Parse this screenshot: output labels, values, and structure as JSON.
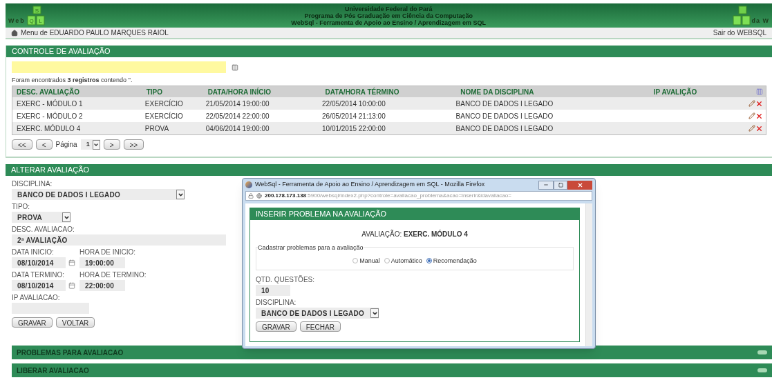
{
  "header": {
    "logo_left": {
      "text": "Web",
      "cube_letters": [
        "S",
        "Q",
        "L"
      ]
    },
    "title_lines": [
      "Universidade Federal do Pará",
      "Programa de Pós Graduação em Ciência da Computação",
      "WebSql - Ferramenta de Apoio ao Ensino / Aprendizagem em SQL"
    ],
    "logo_right": {
      "text": "da W"
    }
  },
  "menu_bar": {
    "user": "Menu de EDUARDO PAULO MARQUES RAIOL",
    "logout": "Sair do WEBSQL"
  },
  "controle": {
    "title": "CONTROLE DE AVALIAÇÃO",
    "result_text": "Foram encontrados **3 registros** contendo ''.",
    "columns": [
      "DESC. AVALIAÇÃO",
      "TIPO",
      "DATA/HORA INÍCIO",
      "DATA/HORA TÉRMINO",
      "NOME DA DISCIPLINA",
      "IP AVALIÇÃO"
    ],
    "rows": [
      {
        "cells": [
          "EXERC - MÓDULO 1",
          "EXERCÍCIO",
          "21/05/2014 19:00:00",
          "22/05/2014 10:00:00",
          "BANCO DE DADOS I LEGADO",
          ""
        ]
      },
      {
        "cells": [
          "EXERC - MÓDULO 2",
          "EXERCÍCIO",
          "22/05/2014 22:00:00",
          "26/05/2014 21:13:00",
          "BANCO DE DADOS I LEGADO",
          ""
        ]
      },
      {
        "cells": [
          "EXERC. MÓDULO 4",
          "PROVA",
          "04/06/2014 19:00:00",
          "10/01/2015 22:00:00",
          "BANCO DE DADOS I LEGADO",
          ""
        ]
      }
    ],
    "pager": {
      "first": "<<",
      "prev": "<",
      "label": "Página",
      "page": "1",
      "next": ">",
      "last": ">>"
    }
  },
  "alterar": {
    "title": "ALTERAR AVALIAÇÃO",
    "disciplina": {
      "label": "DISCIPLINA:",
      "value": "BANCO DE DADOS I LEGADO"
    },
    "tipo": {
      "label": "TIPO:",
      "value": "PROVA"
    },
    "desc": {
      "label": "DESC. AVALIACAO:",
      "value": "2ª AVALIAÇÃO"
    },
    "inicio": {
      "date_label": "DATA INICIO:",
      "date": "08/10/2014",
      "time_label": "HORA DE INICIO:",
      "time": "19:00:00"
    },
    "termino": {
      "date_label": "DATA TERMINO:",
      "date": "08/10/2014",
      "time_label": "HORA DE TERMINO:",
      "time": "22:00:00"
    },
    "ip": {
      "label": "IP AVALIACAO:"
    },
    "buttons": [
      "GRAVAR",
      "VOLTAR"
    ]
  },
  "collapsed_sections": [
    {
      "title": "PROBLEMAS PARA AVALIACAO"
    },
    {
      "title": "LIBERAR AVALIACAO"
    }
  ],
  "popup": {
    "window_title": "WebSql - Ferramenta de Apoio ao Ensino / Aprendizagem em SQL - Mozilla Firefox",
    "url_host": "200.178.173.138",
    "url_path": ":5900/websql/index2.php?controle=avaliacao_problema&acao=inserir&idavaliacao=",
    "panel_title": "INSERIR PROBLEMA NA AVALIAÇÃO",
    "avaliacao_label": "AVALIAÇÃO:",
    "avaliacao_value": "EXERC. MÓDULO 4",
    "fieldset_legend": "Cadastrar problemas para a avaliação",
    "options": [
      {
        "label": "Manual",
        "selected": false
      },
      {
        "label": "Automático",
        "selected": false
      },
      {
        "label": "Recomendação",
        "selected": true
      }
    ],
    "qtd": {
      "label": "QTD. QUESTÕES:",
      "value": "10"
    },
    "disciplina": {
      "label": "DISCIPLINA:",
      "value": "BANCO DE DADOS I LEGADO"
    },
    "buttons": [
      "GRAVAR",
      "FECHAR"
    ]
  }
}
